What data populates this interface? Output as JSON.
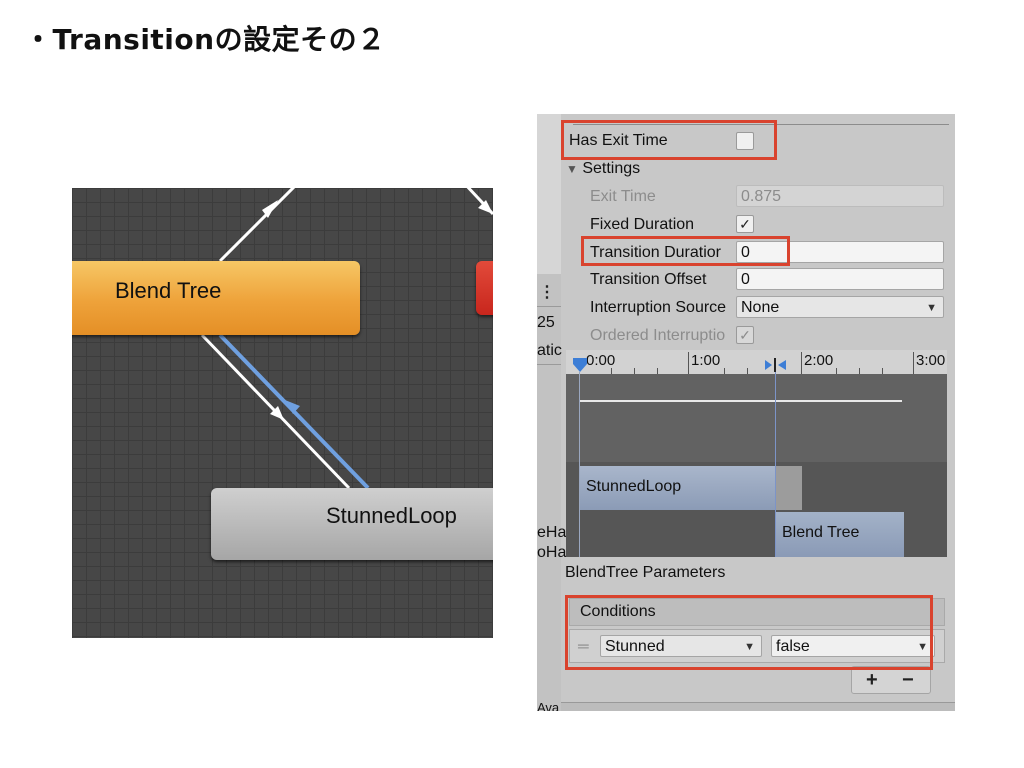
{
  "slide": {
    "title": "・Transitionの設定その２"
  },
  "graph": {
    "nodes": {
      "blend_tree": "Blend Tree",
      "stunned_loop": "StunnedLoop"
    },
    "colors": {
      "blend_node": "#eea23a",
      "red_node": "#c8261d",
      "stunned_node": "#b5b5b5",
      "transition_selected": "#6fa0e0"
    }
  },
  "inspector": {
    "left_strip": {
      "menu": "⋮",
      "t1": "25",
      "t2": "atic",
      "t3": "eHa",
      "t4": "oHa",
      "t5": "Ava"
    },
    "has_exit_time": {
      "label": "Has Exit Time",
      "checked": false
    },
    "settings": {
      "header": "Settings",
      "exit_time": {
        "label": "Exit Time",
        "value": "0.875"
      },
      "fixed_duration": {
        "label": "Fixed Duration",
        "checked": true,
        "mark": "✓"
      },
      "transition_duration": {
        "label": "Transition Duratior",
        "value": "0"
      },
      "transition_offset": {
        "label": "Transition Offset",
        "value": "0"
      },
      "interruption_source": {
        "label": "Interruption Source",
        "value": "None"
      },
      "ordered_interruption": {
        "label": "Ordered Interruptio",
        "mark": "✓"
      }
    },
    "timeline": {
      "ticks": [
        "0:00",
        "1:00",
        "2:00",
        "3:00"
      ],
      "clips": {
        "from": "StunnedLoop",
        "to": "Blend Tree"
      }
    },
    "parameters_label": "BlendTree Parameters",
    "conditions": {
      "header": "Conditions",
      "items": [
        {
          "parameter": "Stunned",
          "value": "false"
        }
      ],
      "add": "+",
      "remove": "−"
    },
    "highlight_color": "#d9432e"
  }
}
